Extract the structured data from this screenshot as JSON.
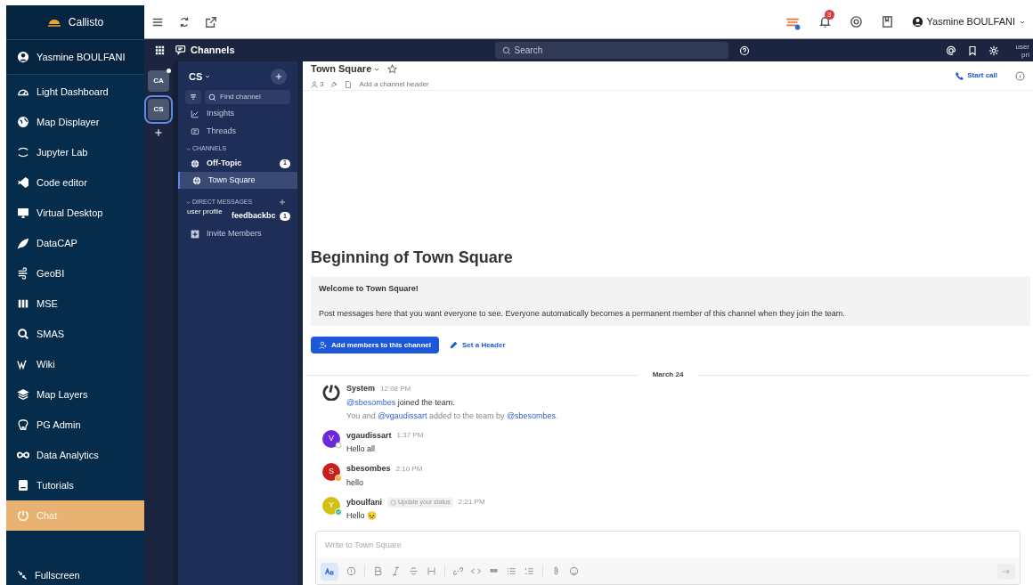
{
  "app_sidebar": {
    "logo": "Callisto",
    "user": "Yasmine BOULFANI",
    "items": [
      {
        "label": "Light Dashboard",
        "selected": false
      },
      {
        "label": "Map Displayer",
        "selected": false
      },
      {
        "label": "Jupyter Lab",
        "selected": false
      },
      {
        "label": "Code editor",
        "selected": false
      },
      {
        "label": "Virtual Desktop",
        "selected": false
      },
      {
        "label": "DataCAP",
        "selected": false
      },
      {
        "label": "GeoBI",
        "selected": false
      },
      {
        "label": "MSE",
        "selected": false
      },
      {
        "label": "SMAS",
        "selected": false
      },
      {
        "label": "Wiki",
        "selected": false
      },
      {
        "label": "Map Layers",
        "selected": false
      },
      {
        "label": "PG Admin",
        "selected": false
      },
      {
        "label": "Data Analytics",
        "selected": false
      },
      {
        "label": "Tutorials",
        "selected": false
      },
      {
        "label": "Chat",
        "selected": true
      }
    ],
    "fullscreen": "Fullscreen"
  },
  "topbar": {
    "notification_count": "3",
    "user": "Yasmine BOULFANI"
  },
  "channels_bar": {
    "title": "Channels",
    "search_placeholder": "Search",
    "avatar_alt": "user pri"
  },
  "teams": [
    {
      "initials": "CA",
      "selected": false,
      "unread": true
    },
    {
      "initials": "CS",
      "selected": true,
      "unread": false
    }
  ],
  "channel_sidebar": {
    "team": "CS",
    "find_placeholder": "Find channel",
    "links": [
      "Insights",
      "Threads"
    ],
    "channels_header": "CHANNELS",
    "channels": [
      {
        "name": "Off-Topic",
        "unread": true,
        "badge": "1",
        "selected": false
      },
      {
        "name": "Town Square",
        "unread": false,
        "selected": true
      }
    ],
    "dm_header": "DIRECT MESSAGES",
    "dms": [
      {
        "avatar_alt": "user profile",
        "name": "feedbackbc",
        "badge": "1"
      }
    ],
    "invite": "Invite Members"
  },
  "channel_header": {
    "name": "Town Square",
    "members": "3",
    "header_placeholder": "Add a channel header",
    "start_call": "Start call"
  },
  "intro": {
    "title": "Beginning of Town Square",
    "welcome": "Welcome to Town Square!",
    "description": "Post messages here that you want everyone to see. Everyone automatically becomes a permanent member of this channel when they join the team.",
    "add_button": "Add members to this channel",
    "set_header": "Set a Header"
  },
  "date_separator": "March 24",
  "messages": [
    {
      "kind": "system",
      "author": "System",
      "time": "12:08 PM",
      "lines": [
        [
          {
            "text": "@sbesombes",
            "kind": "mention"
          },
          {
            "text": " joined the team.",
            "kind": "plain"
          }
        ],
        [
          {
            "text": "You and ",
            "kind": "muted"
          },
          {
            "text": "@vgaudissart",
            "kind": "mention"
          },
          {
            "text": " added to the team by ",
            "kind": "muted"
          },
          {
            "text": "@sbesombes",
            "kind": "mention"
          },
          {
            "text": ".",
            "kind": "muted"
          }
        ]
      ]
    },
    {
      "kind": "user",
      "author": "vgaudissart",
      "initial": "V",
      "color": "#6d28d9",
      "online": false,
      "away": false,
      "time": "1:37 PM",
      "text": "Hello all"
    },
    {
      "kind": "user",
      "author": "sbesombes",
      "initial": "S",
      "color": "#c81e1e",
      "online": false,
      "away": true,
      "time": "2:10 PM",
      "text": "hello"
    },
    {
      "kind": "user",
      "author": "yboulfani",
      "initial": "Y",
      "color": "#d4c012",
      "online": true,
      "away": false,
      "status_button": "Update your status",
      "time": "2:21 PM",
      "text": "Hello 😣"
    }
  ],
  "composer": {
    "placeholder": "Write to Town Square"
  }
}
